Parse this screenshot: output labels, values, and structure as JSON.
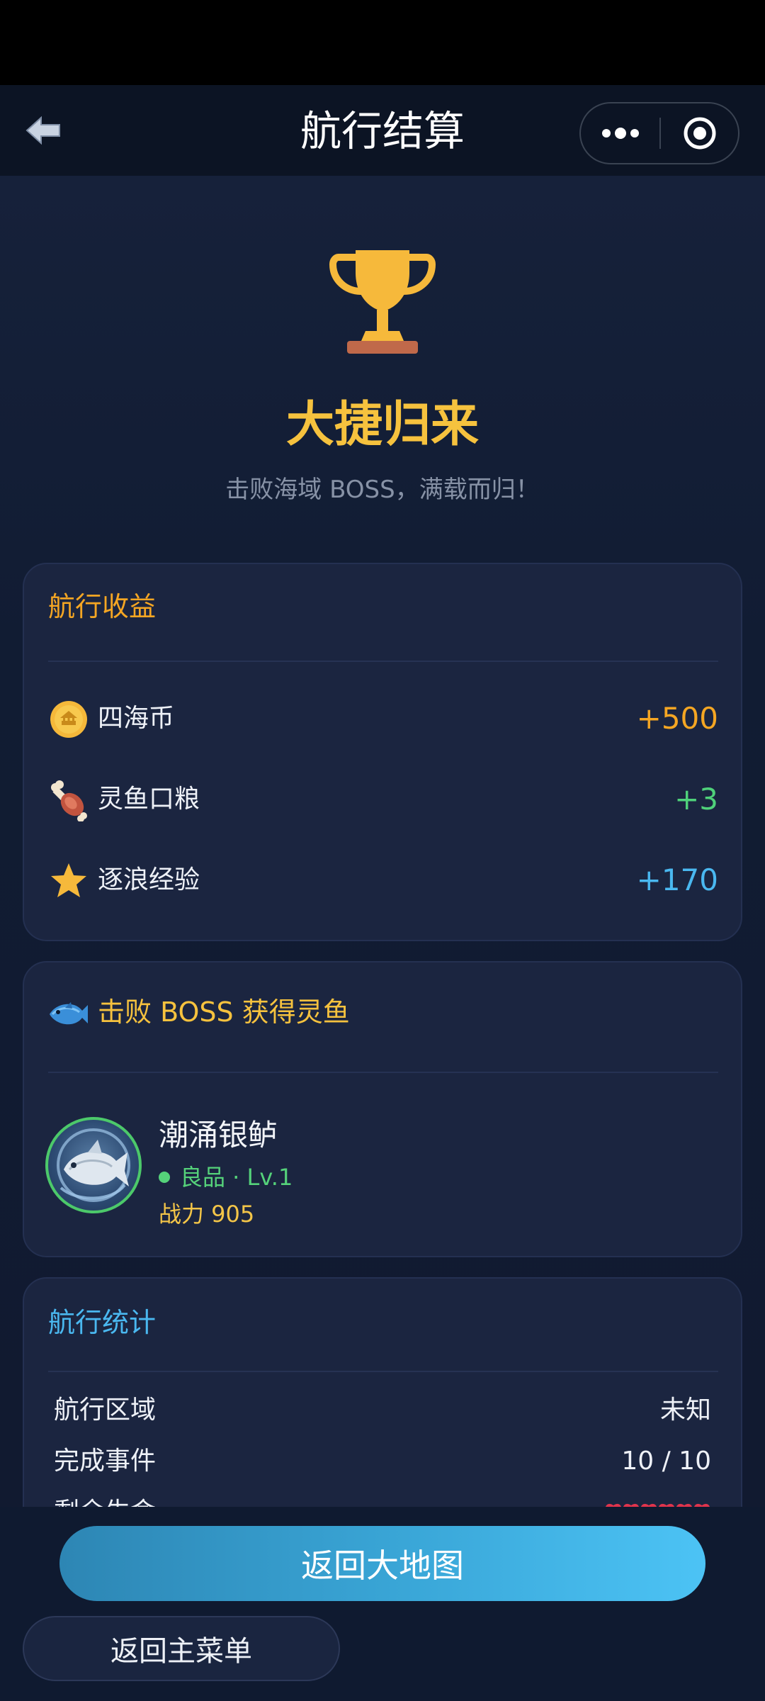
{
  "nav": {
    "title": "航行结算",
    "back_icon": "back-arrow-icon",
    "more_icon": "more-dots-icon",
    "close_icon": "target-close-icon"
  },
  "hero": {
    "icon": "trophy-icon",
    "title": "大捷归来",
    "subtitle": "击败海域 BOSS，满载而归！"
  },
  "rewards": {
    "title": "航行收益",
    "items": [
      {
        "icon": "coin-icon",
        "label": "四海币",
        "value": "+500",
        "color": "#f5a623"
      },
      {
        "icon": "meat-icon",
        "label": "灵鱼口粮",
        "value": "+3",
        "color": "#4fd17a"
      },
      {
        "icon": "star-icon",
        "label": "逐浪经验",
        "value": "+170",
        "color": "#4ab8f0"
      }
    ]
  },
  "boss_reward": {
    "icon": "fish-icon",
    "title": "击败 BOSS 获得灵鱼",
    "fish": {
      "name": "潮涌银鲈",
      "grade_level": "良品 · Lv.1",
      "power": "战力 905"
    }
  },
  "stats": {
    "title": "航行统计",
    "rows": [
      {
        "label": "航行区域",
        "value": "未知"
      },
      {
        "label": "完成事件",
        "value": "10 / 10"
      },
      {
        "label": "剩余生命",
        "value": ""
      }
    ],
    "hearts_icon": "heart-icon"
  },
  "actions": {
    "primary": "返回大地图",
    "secondary": "返回主菜单"
  },
  "colors": {
    "accent_gold": "#f6c23e",
    "accent_blue": "#4cc3f5",
    "card_bg": "#1b2540"
  }
}
